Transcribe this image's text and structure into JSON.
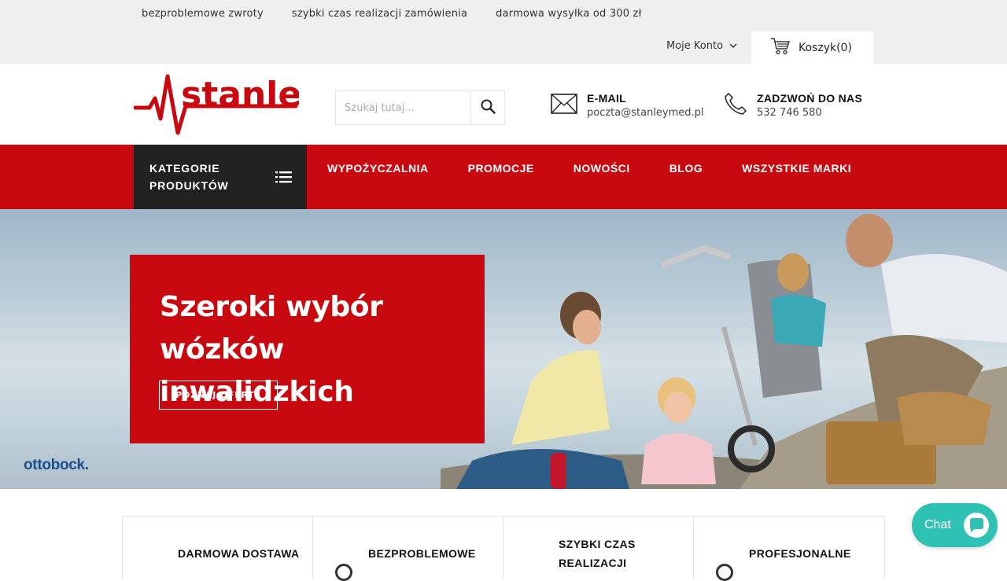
{
  "topbar": {
    "perks": [
      "bezproblemowe zwroty",
      "szybki czas realizacji zamówienia",
      "darmowa wysyłka od 300 zł"
    ],
    "account_label": "Moje Konto",
    "cart_label": "Koszyk",
    "cart_count": "(0)"
  },
  "header": {
    "logo_text": "stanley",
    "search_placeholder": "Szukaj tutaj...",
    "email_title": "E-MAIL",
    "email_value": "poczta@stanleymed.pl",
    "phone_title": "ZADZWOŃ DO NAS",
    "phone_value": "532 746 580"
  },
  "nav": {
    "categories_line1": "KATEGORIE",
    "categories_line2": "PRODUKTÓW",
    "links": [
      "WYPOŻYCZALNIA",
      "PROMOCJE",
      "NOWOŚCI",
      "BLOG",
      "WSZYSTKIE MARKI"
    ]
  },
  "hero": {
    "headline_line1": "Szeroki wybór",
    "headline_line2": "wózków inwalidzkich",
    "cta": "POZNAJ OFERTĘ",
    "brand": "ottobock."
  },
  "features": [
    {
      "line1": "DARMOWA DOSTAWA",
      "line2": ""
    },
    {
      "line1": "BEZPROBLEMOWE",
      "line2": ""
    },
    {
      "line1": "SZYBKI CZAS",
      "line2": "REALIZACJI"
    },
    {
      "line1": "PROFESJONALNE",
      "line2": ""
    }
  ],
  "chat": {
    "label": "Chat"
  },
  "colors": {
    "brand_red": "#c8090f",
    "dark": "#222222",
    "chat_teal": "#2fc2b4",
    "topbar_bg": "#efefef"
  }
}
